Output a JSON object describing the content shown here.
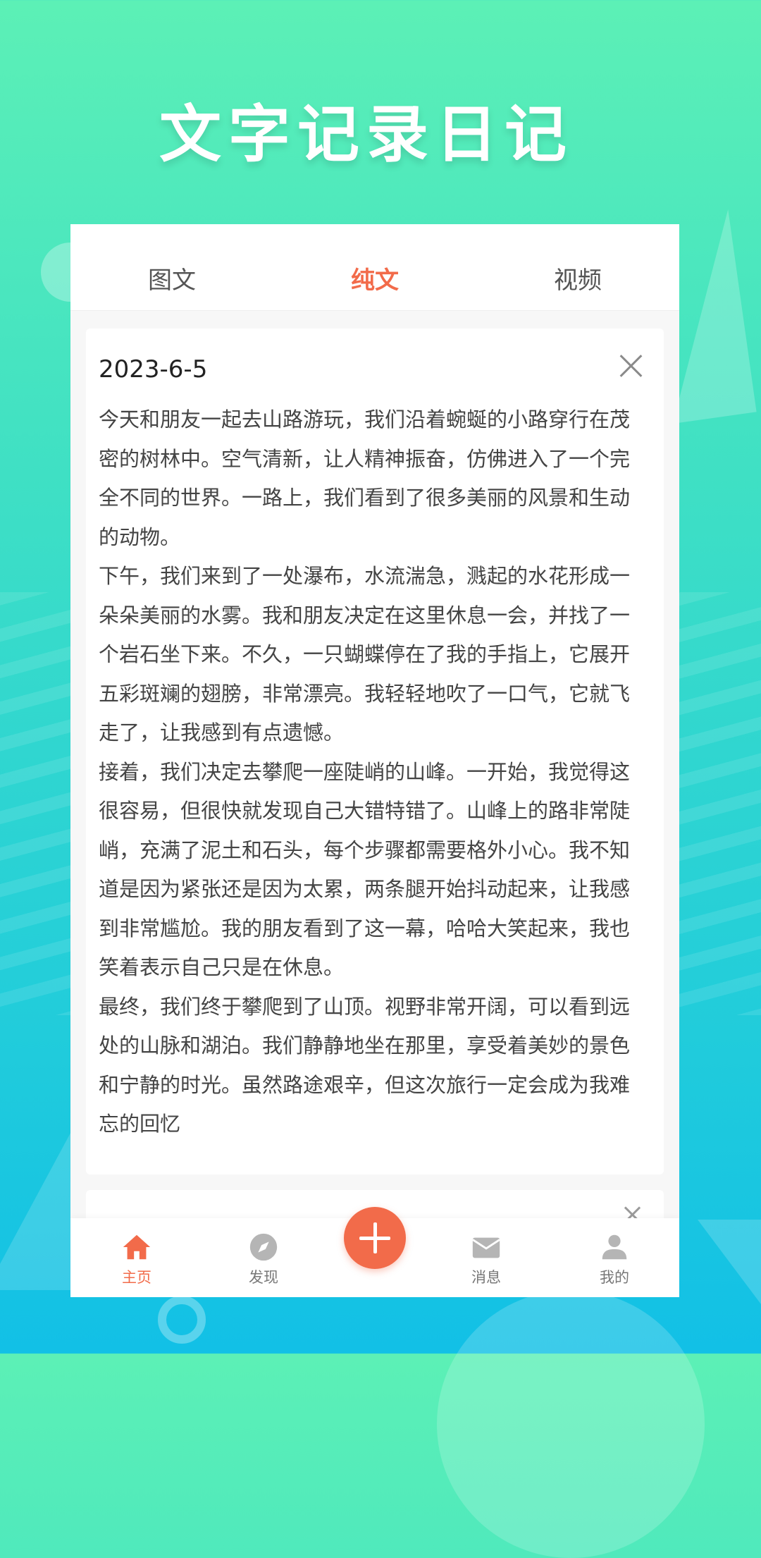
{
  "hero": {
    "title": "文字记录日记"
  },
  "tabs": [
    {
      "label": "图文",
      "active": false
    },
    {
      "label": "纯文",
      "active": true
    },
    {
      "label": "视频",
      "active": false
    }
  ],
  "entries": [
    {
      "date": "2023-6-5",
      "paragraphs": [
        "今天和朋友一起去山路游玩，我们沿着蜿蜒的小路穿行在茂密的树林中。空气清新，让人精神振奋，仿佛进入了一个完全不同的世界。一路上，我们看到了很多美丽的风景和生动的动物。",
        "下午，我们来到了一处瀑布，水流湍急，溅起的水花形成一朵朵美丽的水雾。我和朋友决定在这里休息一会，并找了一个岩石坐下来。不久，一只蝴蝶停在了我的手指上，它展开五彩斑斓的翅膀，非常漂亮。我轻轻地吹了一口气，它就飞走了，让我感到有点遗憾。",
        "接着，我们决定去攀爬一座陡峭的山峰。一开始，我觉得这很容易，但很快就发现自己大错特错了。山峰上的路非常陡峭，充满了泥土和石头，每个步骤都需要格外小心。我不知道是因为紧张还是因为太累，两条腿开始抖动起来，让我感到非常尴尬。我的朋友看到了这一幕，哈哈大笑起来，我也笑着表示自己只是在休息。",
        "最终，我们终于攀爬到了山顶。视野非常开阔，可以看到远处的山脉和湖泊。我们静静地坐在那里，享受着美妙的景色和宁静的时光。虽然路途艰辛，但这次旅行一定会成为我难忘的回忆"
      ]
    }
  ],
  "nav": {
    "items": [
      {
        "label": "主页",
        "icon": "home-icon",
        "active": true
      },
      {
        "label": "发现",
        "icon": "compass-icon",
        "active": false
      },
      {
        "label": "消息",
        "icon": "mail-icon",
        "active": false
      },
      {
        "label": "我的",
        "icon": "user-icon",
        "active": false
      }
    ],
    "fab_icon": "plus-icon"
  },
  "colors": {
    "accent": "#f26b4a",
    "inactive_icon": "#b5b5b5",
    "text": "#444444"
  }
}
